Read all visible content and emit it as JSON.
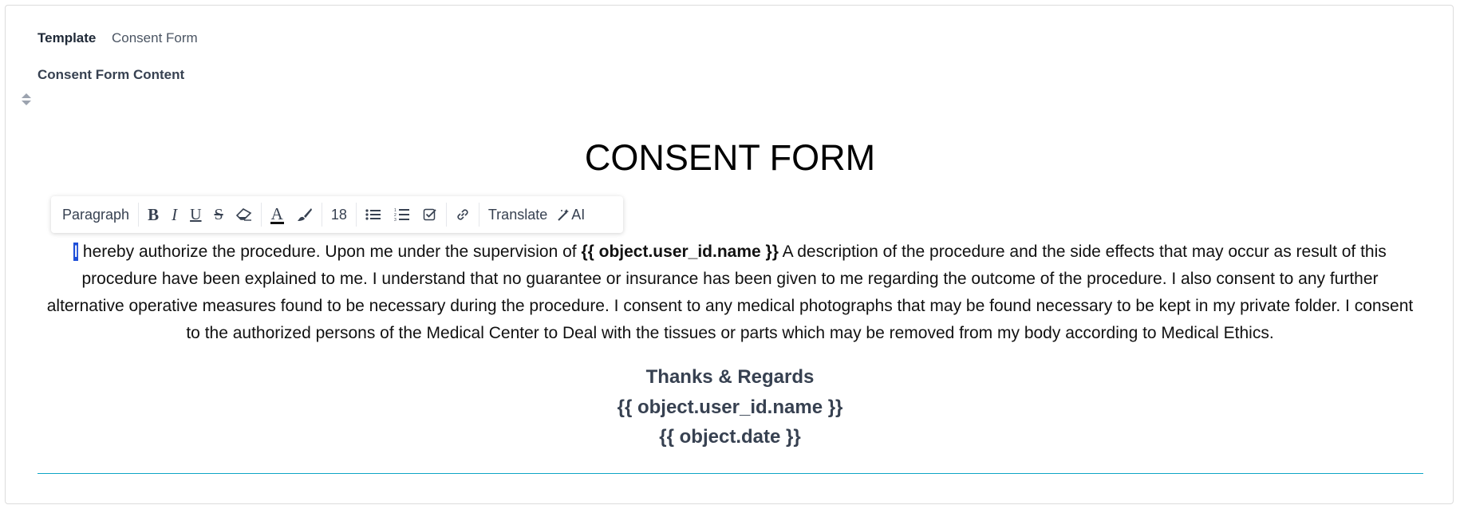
{
  "template": {
    "label": "Template",
    "value": "Consent Form"
  },
  "field": {
    "label": "Consent Form Content"
  },
  "toolbar": {
    "paragraph": "Paragraph",
    "font_size": "18",
    "translate": "Translate",
    "ai": "AI"
  },
  "document": {
    "title": "CONSENT FORM",
    "caret_char": "I",
    "body_part1": " hereby authorize the procedure. Upon me under the supervision of ",
    "body_var": "{{ object.user_id.name }}",
    "body_part2": " A description of the procedure and the side effects that may occur as result of this procedure have been explained to me. I understand that no guarantee or insurance has been given to me regarding the outcome of the procedure. I also consent to any further alternative operative measures found to be necessary during the procedure. I consent to any medical photographs that may be found necessary to be kept in my private folder. I consent to the authorized persons of the Medical Center to Deal with the tissues or parts which may be removed from my body according to Medical Ethics.",
    "closing": "Thanks & Regards",
    "signer": "{{ object.user_id.name }}",
    "date": "{{ object.date }}"
  },
  "colors": {
    "accent_rule": "#0ea5c6",
    "caret": "#1d4ed8"
  },
  "icons": [
    "sort-icon",
    "bold-icon",
    "italic-icon",
    "underline-icon",
    "strikethrough-icon",
    "eraser-icon",
    "font-color-icon",
    "brush-icon",
    "bullet-list-icon",
    "numbered-list-icon",
    "checklist-icon",
    "link-icon",
    "magic-wand-icon"
  ]
}
